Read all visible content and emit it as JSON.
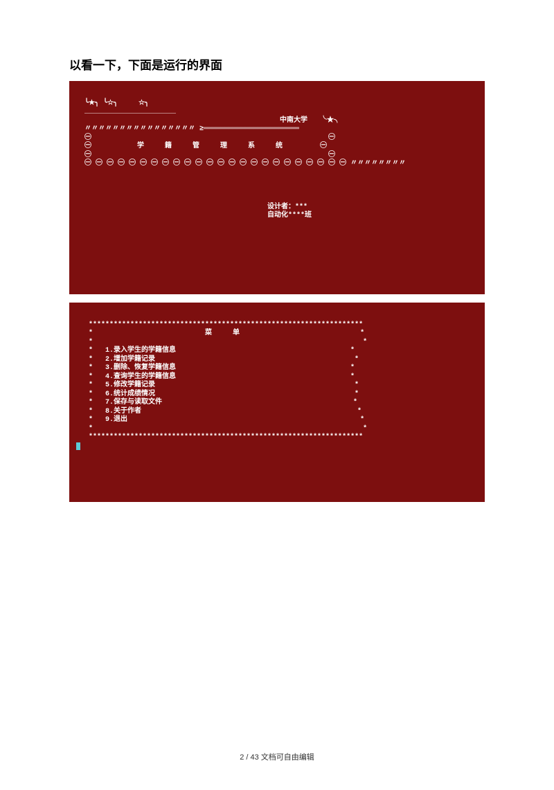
{
  "intro": "以看一下，下面是运行的界面",
  "screen1": {
    "line1": "  ╰★╮ ╰☆╮     ☆╮",
    "line2": "  ______________________",
    "line3": "                                                 中南大学   ╰★╮",
    "line4": "  〃〃〃〃〃〃〃〃〃〃〃〃〃〃〃〃 ≥═══════════════════════",
    "line5": "  ㊀                                                         ㊀",
    "line6": "  ㊀           学     籍     管     理     系     统         ㊀",
    "line7": "  ㊀                                                         ㊀",
    "line8": "  ㊀ ㊀ ㊀ ㊀ ㊀ ㊀ ㊀ ㊀ ㊀ ㊀ ㊀ ㊀ ㊀ ㊀ ㊀ ㊀ ㊀ ㊀ ㊀ ㊀ ㊀ ㊀ ㊀ ㊀ 〃〃〃〃〃〃〃〃",
    "designer": "                                              设计者：***",
    "class": "                                              自动化****班"
  },
  "screen2": {
    "border_top": "   ******************************************************************",
    "title_line": "   *                           菜     单                             *",
    "items": [
      "   *   1.录入学生的学籍信息                                          *",
      "   *   2.增加学籍记录                                                *",
      "   *   3.删除、恢复学籍信息                                          *",
      "   *   4.查询学生的学籍信息                                          *",
      "   *   5.修改学籍记录                                                *",
      "   *   6.统计成绩情况                                                *",
      "   *   7.保存与读取文件                                              *",
      "   *   8.关于作者                                                    *",
      "   *   9.退出                                                        *"
    ],
    "blank": "   *                                                                 *",
    "border_bottom": "   ******************************************************************",
    "cursor": "-"
  },
  "footer": "2 / 43 文档可自由编辑"
}
